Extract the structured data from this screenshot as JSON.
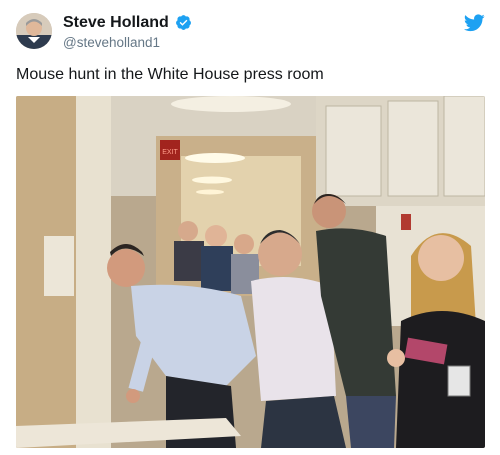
{
  "author": {
    "name": "Steve Holland",
    "handle": "@steveholland1",
    "verified": true
  },
  "tweet": {
    "text": "Mouse hunt in the White House press room"
  },
  "photo": {
    "exit_sign_text": "EXIT"
  },
  "icons": {
    "verified": "verified-badge-icon",
    "brand": "twitter-bird-icon"
  },
  "colors": {
    "brand": "#1da1f2",
    "text": "#14171a",
    "secondary": "#657786"
  }
}
